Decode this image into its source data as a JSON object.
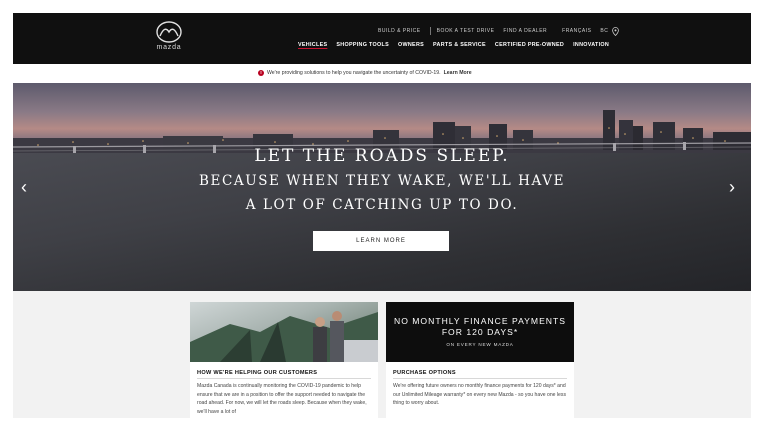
{
  "brand": {
    "wordmark": "mazda"
  },
  "utility_nav": {
    "build_price": "BUILD & PRICE",
    "test_drive": "BOOK A TEST DRIVE",
    "find_dealer": "FIND A DEALER",
    "language": "FRANÇAIS",
    "region": "BC"
  },
  "main_nav": [
    "VEHICLES",
    "SHOPPING TOOLS",
    "OWNERS",
    "PARTS & SERVICE",
    "CERTIFIED PRE-OWNED",
    "INNOVATION"
  ],
  "covid_banner": {
    "alert_glyph": "!",
    "text": "We're providing solutions to help you navigate the uncertainty of COVID-19.",
    "link": "Learn More"
  },
  "hero": {
    "line1": "LET THE ROADS SLEEP.",
    "line2": "BECAUSE WHEN THEY WAKE, WE'LL HAVE",
    "line3": "A LOT OF CATCHING UP TO DO.",
    "cta": "LEARN MORE",
    "prev_glyph": "‹",
    "next_glyph": "›"
  },
  "cards": {
    "helping": {
      "title": "HOW WE'RE HELPING OUR CUSTOMERS",
      "body": "Mazda Canada is continually monitoring the COVID-19 pandemic to help ensure that we are in a position to offer the support needed to navigate the road ahead. For now, we will let the roads sleep. Because when they wake, we'll have a lot of"
    },
    "finance": {
      "promo_line1": "NO MONTHLY FINANCE PAYMENTS",
      "promo_line2": "FOR 120 DAYS*",
      "promo_line3": "ON EVERY NEW MAZDA",
      "title": "PURCHASE OPTIONS",
      "body": "We're offering future owners no monthly finance payments for 120 days* and our Unlimited Mileage warranty* on every new Mazda - so you have one less thing to worry about."
    }
  },
  "colors": {
    "nav_bg": "#101010",
    "accent_red": "#c8102e",
    "promo_bg": "#0d0d0d"
  }
}
